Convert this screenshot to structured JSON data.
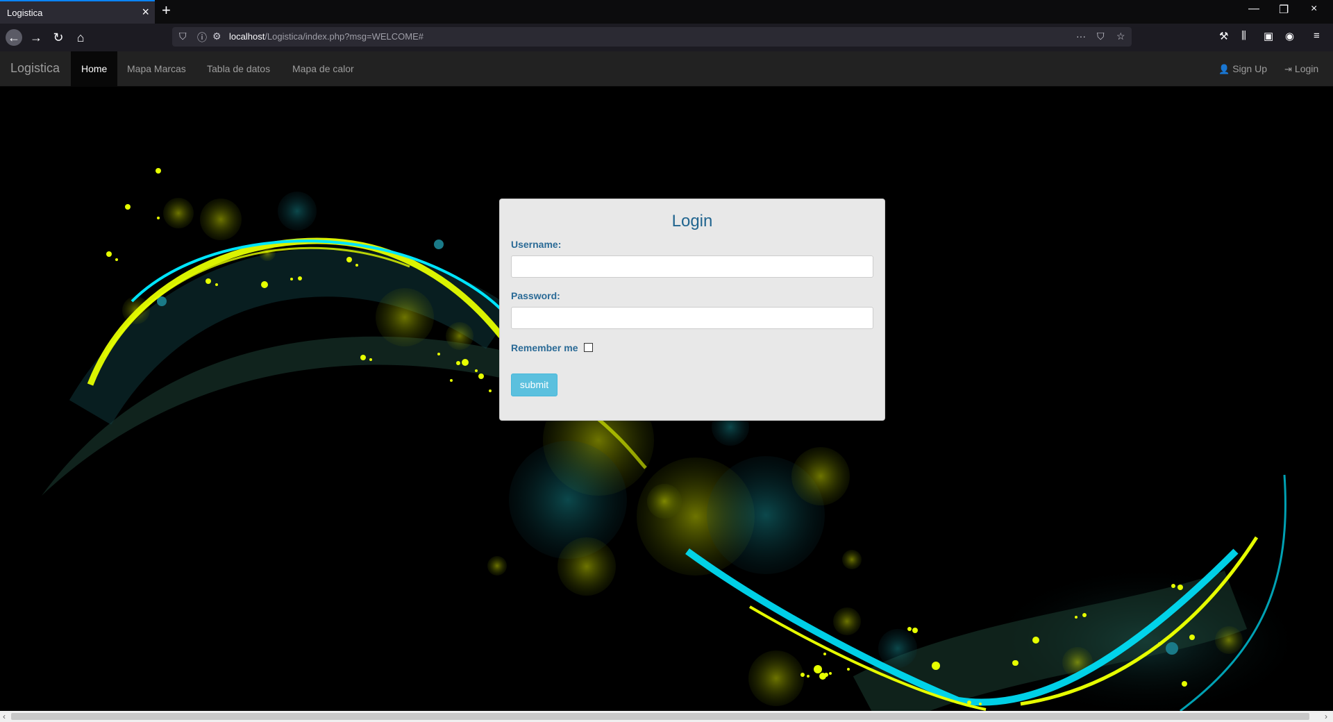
{
  "browser": {
    "tab_title": "Logistica",
    "url_host": "localhost",
    "url_path": "/Logistica/index.php?msg=WELCOME#"
  },
  "icons": {
    "close": "×",
    "new_tab": "+",
    "back": "←",
    "forward": "→",
    "reload": "↻",
    "home": "⌂",
    "shield": "⛉",
    "info": "ⓘ",
    "more": "···",
    "pocket": "⛉",
    "star": "☆",
    "tools": "⚒",
    "library": "⫼",
    "sidebar": "▣",
    "account": "◉",
    "menu": "≡",
    "minimize": "—",
    "restore": "❐",
    "user": "👤",
    "login": "⇥"
  },
  "navbar": {
    "brand": "Logistica",
    "items": [
      {
        "label": "Home",
        "active": true
      },
      {
        "label": "Mapa Marcas",
        "active": false
      },
      {
        "label": "Tabla de datos",
        "active": false
      },
      {
        "label": "Mapa de calor",
        "active": false
      }
    ],
    "right": [
      {
        "label": "Sign Up",
        "icon": "user-icon"
      },
      {
        "label": "Login",
        "icon": "login-icon"
      }
    ]
  },
  "login_form": {
    "title": "Login",
    "username_label": "Username:",
    "username_value": "",
    "password_label": "Password:",
    "password_value": "",
    "remember_label": "Remember me",
    "remember_checked": false,
    "submit_label": "submit"
  },
  "colors": {
    "brand_teal": "#21658f",
    "submit_bg": "#5bc0de",
    "neon_yellow": "#e6ff00",
    "neon_cyan": "#00e5ff"
  }
}
